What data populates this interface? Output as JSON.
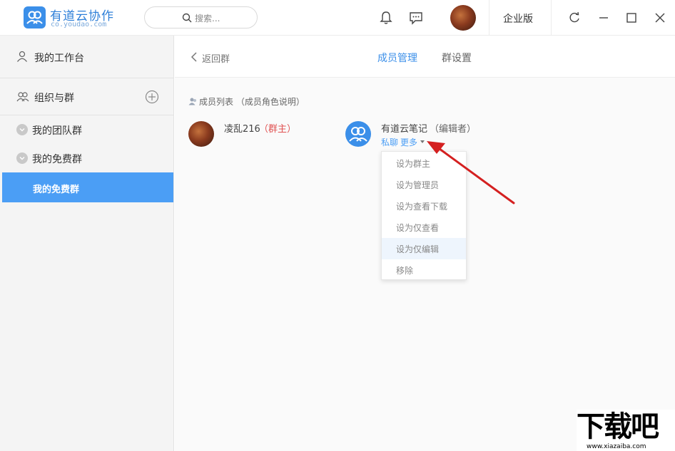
{
  "app": {
    "title": "有道云协作",
    "subtitle": "co.youdao.com"
  },
  "search": {
    "placeholder": "搜索..."
  },
  "topbar": {
    "icons": [
      "bell-icon",
      "chat-icon"
    ],
    "enterprise_label": "企业版",
    "window_controls": [
      "refresh-icon",
      "minimize-icon",
      "maximize-icon",
      "close-icon"
    ]
  },
  "sidebar": {
    "workspace": "我的工作台",
    "org_group": "组织与群",
    "items": [
      {
        "label": "我的团队群"
      },
      {
        "label": "我的免费群"
      },
      {
        "label": "我的免费群"
      }
    ]
  },
  "main": {
    "back_label": "返回群",
    "tabs": [
      {
        "label": "成员管理",
        "active": true
      },
      {
        "label": "群设置",
        "active": false
      }
    ],
    "list_header": "成员列表 （成员角色说明）",
    "members": [
      {
        "name": "凌乱216",
        "role": "（群主）"
      },
      {
        "name": "有道云笔记",
        "role": "（编辑者）",
        "actions": [
          "私聊",
          "更多"
        ]
      }
    ],
    "menu": [
      "设为群主",
      "设为管理员",
      "设为查看下载",
      "设为仅查看",
      "设为仅编辑",
      "移除"
    ]
  },
  "watermark": {
    "big": "下载吧",
    "small": "www.xiazaiba.com"
  },
  "colors": {
    "accent": "#3b8fe9",
    "active_bg": "#4b9ef5",
    "owner_role": "#e05252",
    "arrow": "#d42020"
  }
}
